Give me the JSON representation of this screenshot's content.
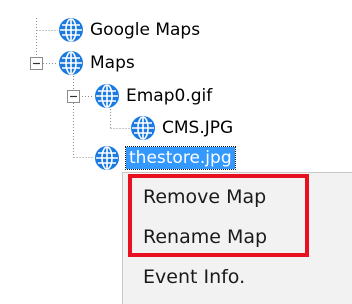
{
  "tree": {
    "nodes": [
      {
        "label": "Google Maps",
        "icon": "globe-icon"
      },
      {
        "label": "Maps",
        "icon": "globe-icon",
        "expanded": true
      },
      {
        "label": "Emap0.gif",
        "icon": "globe-icon",
        "expanded": true
      },
      {
        "label": "CMS.JPG",
        "icon": "globe-icon"
      },
      {
        "label": "thestore.jpg",
        "icon": "globe-icon",
        "selected": true
      }
    ]
  },
  "context_menu": {
    "items": [
      {
        "label": "Remove Map"
      },
      {
        "label": "Rename Map"
      },
      {
        "label": "Event Info."
      }
    ]
  },
  "colors": {
    "selection": "#3399ff",
    "globe": "#1a7ae0",
    "highlight_box": "#e8101e",
    "menu_bg": "#f2f2f2"
  }
}
